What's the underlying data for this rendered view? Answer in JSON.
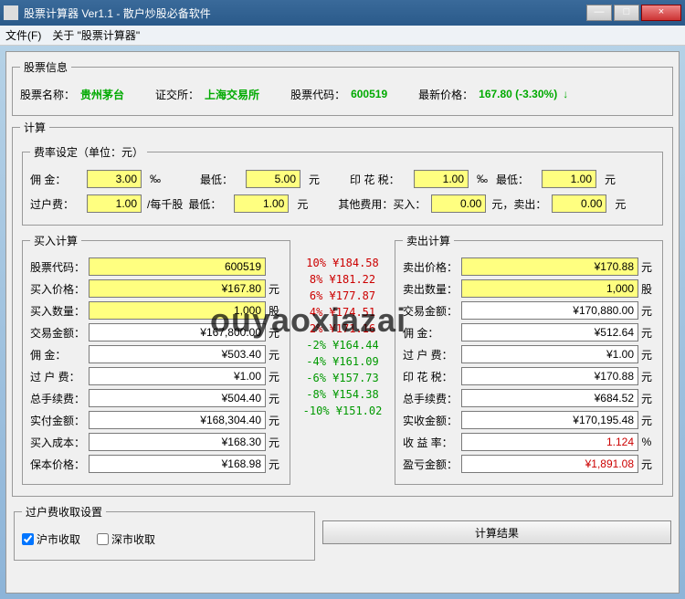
{
  "window": {
    "title": "股票计算器 Ver1.1 - 散户炒股必备软件",
    "min": "—",
    "max": "□",
    "close": "×"
  },
  "menu": {
    "file": "文件(F)",
    "about": "关于 \"股票计算器\""
  },
  "stock": {
    "legend": "股票信息",
    "name_lbl": "股票名称：",
    "name": "贵州茅台",
    "exch_lbl": "证交所：",
    "exch": "上海交易所",
    "code_lbl": "股票代码：",
    "code": "600519",
    "price_lbl": "最新价格：",
    "price": "167.80 (-3.30%)",
    "arrow": "↓"
  },
  "calc": {
    "legend": "计算",
    "rate_legend": "费率设定（单位：元）",
    "comm_lbl": "佣  金：",
    "comm": "3.00",
    "pct": "‰",
    "min_lbl": "最低：",
    "comm_min": "5.00",
    "yuan": "元",
    "stamp_lbl": "印 花 税：",
    "stamp": "1.00",
    "stamp_min_lbl": "最低：",
    "stamp_min": "1.00",
    "xfer_lbl": "过户费：",
    "xfer": "1.00",
    "xfer_unit": "/每千股",
    "xfer_min_lbl": "最低：",
    "xfer_min": "1.00",
    "other_lbl": "其他费用：买入：",
    "other_buy": "0.00",
    "other_mid": "元，卖出：",
    "other_sell": "0.00"
  },
  "buy": {
    "legend": "买入计算",
    "code_lbl": "股票代码：",
    "code": "600519",
    "price_lbl": "买入价格：",
    "price": "¥167.80",
    "unit_yuan": "元",
    "qty_lbl": "买入数量：",
    "qty": "1,000",
    "unit_gu": "股",
    "amt_lbl": "交易金额：",
    "amt": "¥167,800.00",
    "comm_lbl": "佣    金：",
    "comm": "¥503.40",
    "xfer_lbl": "过 户 费：",
    "xfer": "¥1.00",
    "fee_lbl": "总手续费：",
    "fee": "¥504.40",
    "pay_lbl": "实付金额：",
    "pay": "¥168,304.40",
    "cost_lbl": "买入成本：",
    "cost": "¥168.30",
    "break_lbl": "保本价格：",
    "break": "¥168.98"
  },
  "pct": [
    {
      "cls": "up",
      "p": "10%",
      "v": "¥184.58"
    },
    {
      "cls": "up",
      "p": "8%",
      "v": "¥181.22"
    },
    {
      "cls": "up",
      "p": "6%",
      "v": "¥177.87"
    },
    {
      "cls": "up",
      "p": "4%",
      "v": "¥174.51"
    },
    {
      "cls": "up",
      "p": "2%",
      "v": "¥171.16"
    },
    {
      "cls": "dn",
      "p": "-2%",
      "v": "¥164.44"
    },
    {
      "cls": "dn",
      "p": "-4%",
      "v": "¥161.09"
    },
    {
      "cls": "dn",
      "p": "-6%",
      "v": "¥157.73"
    },
    {
      "cls": "dn",
      "p": "-8%",
      "v": "¥154.38"
    },
    {
      "cls": "dn",
      "p": "-10%",
      "v": "¥151.02"
    }
  ],
  "sell": {
    "legend": "卖出计算",
    "price_lbl": "卖出价格：",
    "price": "¥170.88",
    "unit_yuan": "元",
    "qty_lbl": "卖出数量：",
    "qty": "1,000",
    "unit_gu": "股",
    "amt_lbl": "交易金额：",
    "amt": "¥170,880.00",
    "comm_lbl": "佣    金：",
    "comm": "¥512.64",
    "xfer_lbl": "过 户 费：",
    "xfer": "¥1.00",
    "stamp_lbl": "印 花 税：",
    "stamp": "¥170.88",
    "fee_lbl": "总手续费：",
    "fee": "¥684.52",
    "recv_lbl": "实收金额：",
    "recv": "¥170,195.48",
    "rate_lbl": "收 益 率：",
    "rate": "1.124",
    "rate_unit": "%",
    "pl_lbl": "盈亏金额：",
    "pl": "¥1,891.08"
  },
  "xfer_fee": {
    "legend": "过户费收取设置",
    "sh": "沪市收取",
    "sz": "深市收取"
  },
  "btn": {
    "calc": "计算结果"
  },
  "watermark": "ouyaoxiazai"
}
